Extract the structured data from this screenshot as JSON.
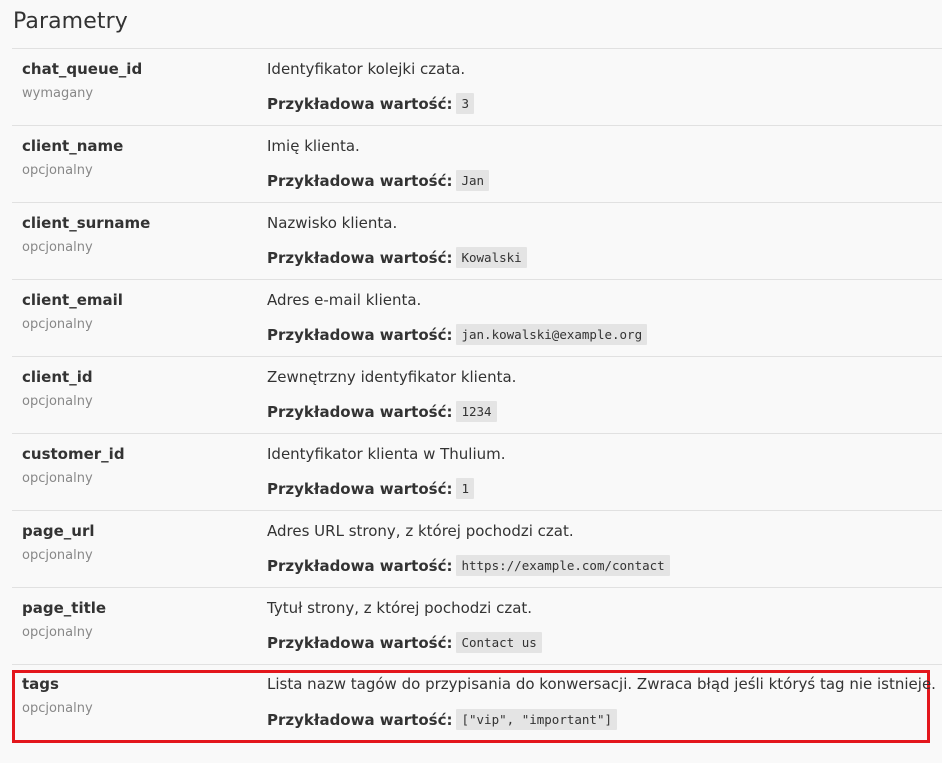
{
  "heading": "Parametry",
  "example_label": "Przykładowa wartość:",
  "params": [
    {
      "name": "chat_queue_id",
      "requirement": "wymagany",
      "description": "Identyfikator kolejki czata.",
      "example": "3"
    },
    {
      "name": "client_name",
      "requirement": "opcjonalny",
      "description": "Imię klienta.",
      "example": "Jan"
    },
    {
      "name": "client_surname",
      "requirement": "opcjonalny",
      "description": "Nazwisko klienta.",
      "example": "Kowalski"
    },
    {
      "name": "client_email",
      "requirement": "opcjonalny",
      "description": "Adres e-mail klienta.",
      "example": "jan.kowalski@example.org"
    },
    {
      "name": "client_id",
      "requirement": "opcjonalny",
      "description": "Zewnętrzny identyfikator klienta.",
      "example": "1234"
    },
    {
      "name": "customer_id",
      "requirement": "opcjonalny",
      "description": "Identyfikator klienta w Thulium.",
      "example": "1"
    },
    {
      "name": "page_url",
      "requirement": "opcjonalny",
      "description": "Adres URL strony, z której pochodzi czat.",
      "example": "https://example.com/contact"
    },
    {
      "name": "page_title",
      "requirement": "opcjonalny",
      "description": "Tytuł strony, z której pochodzi czat.",
      "example": "Contact us"
    },
    {
      "name": "tags",
      "requirement": "opcjonalny",
      "description": "Lista nazw tagów do przypisania do konwersacji. Zwraca błąd jeśli któryś tag nie istnieje.",
      "example": "[\"vip\", \"important\"]"
    }
  ],
  "colors": {
    "highlight_border": "#e3161c",
    "code_background": "#e4e4e4",
    "page_background": "#f9f9f9"
  }
}
